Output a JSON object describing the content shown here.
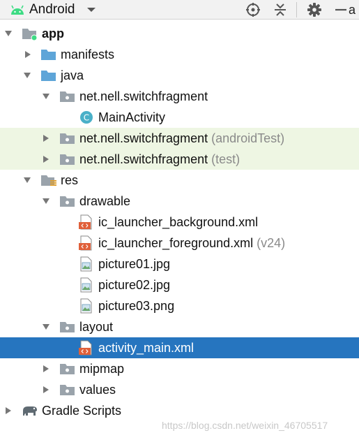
{
  "toolbar": {
    "view_label": "Android",
    "tail_text": "a"
  },
  "tree": [
    {
      "label": "app",
      "suffix": "",
      "bold": true
    },
    {
      "label": "manifests",
      "suffix": ""
    },
    {
      "label": "java",
      "suffix": ""
    },
    {
      "label": "net.nell.switchfragment",
      "suffix": ""
    },
    {
      "label": "MainActivity",
      "suffix": ""
    },
    {
      "label": "net.nell.switchfragment",
      "suffix": "(androidTest)"
    },
    {
      "label": "net.nell.switchfragment",
      "suffix": "(test)"
    },
    {
      "label": "res",
      "suffix": ""
    },
    {
      "label": "drawable",
      "suffix": ""
    },
    {
      "label": "ic_launcher_background.xml",
      "suffix": ""
    },
    {
      "label": "ic_launcher_foreground.xml",
      "suffix": "(v24)"
    },
    {
      "label": "picture01.jpg",
      "suffix": ""
    },
    {
      "label": "picture02.jpg",
      "suffix": ""
    },
    {
      "label": "picture03.png",
      "suffix": ""
    },
    {
      "label": "layout",
      "suffix": ""
    },
    {
      "label": "activity_main.xml",
      "suffix": ""
    },
    {
      "label": "mipmap",
      "suffix": ""
    },
    {
      "label": "values",
      "suffix": ""
    },
    {
      "label": "Gradle Scripts",
      "suffix": ""
    }
  ],
  "watermark": "https://blog.csdn.net/weixin_46705517",
  "colors": {
    "selection": "#2675bf",
    "test_row_bg": "#eef6e3",
    "folder": "#5ea5d8",
    "package": "#9aa3ab",
    "xml_icon": "#e0603a",
    "class_icon": "#4ab0c8",
    "android_green": "#3ddc84"
  }
}
